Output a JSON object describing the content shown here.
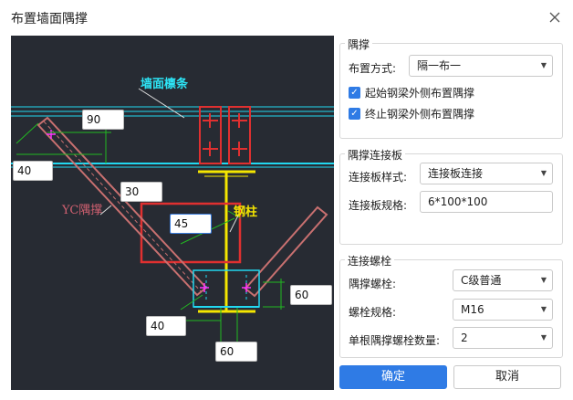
{
  "window": {
    "title": "布置墙面隅撑",
    "close_icon": "close-icon"
  },
  "drawing": {
    "wall_purlin_label": "墙面檩条",
    "brace_label": "YC隅撑",
    "column_label": "钢柱",
    "dims": {
      "d90": "90",
      "d40_top": "40",
      "d30": "30",
      "d45": "45",
      "d60_right": "60",
      "d40_bottom": "40",
      "d60_bottom": "60"
    },
    "colors": {
      "bg": "#272b33",
      "cyan": "#22d8f0",
      "yellow": "#f5e600",
      "red": "#e03030",
      "brace": "#c87070",
      "green": "#22b822",
      "magenta": "#ff33ff"
    }
  },
  "brace_group": {
    "label": "隅撑",
    "layout_label": "布置方式:",
    "layout_value": "隔一布一",
    "start_outside": {
      "label": "起始钢梁外侧布置隅撑",
      "checked": true
    },
    "end_outside": {
      "label": "终止钢梁外侧布置隅撑",
      "checked": true
    }
  },
  "plate_group": {
    "label": "隅撑连接板",
    "style_label": "连接板样式:",
    "style_value": "连接板连接",
    "spec_label": "连接板规格:",
    "spec_value": "6*100*100"
  },
  "bolt_group": {
    "label": "连接螺栓",
    "bolt_label": "隅撑螺栓:",
    "bolt_value": "C级普通",
    "spec_label": "螺栓规格:",
    "spec_value": "M16",
    "count_label": "单根隅撑螺栓数量:",
    "count_value": "2"
  },
  "buttons": {
    "ok": "确定",
    "cancel": "取消"
  }
}
